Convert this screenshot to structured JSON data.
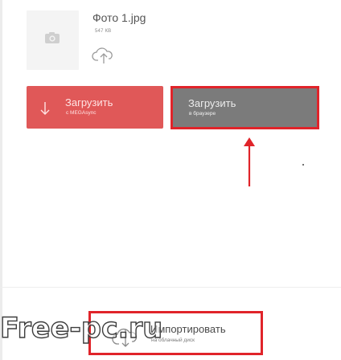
{
  "file": {
    "name": "Фото 1.jpg",
    "size": "547 КВ",
    "thumbnail_icon": "camera-icon",
    "cloud_icon": "cloud-upload-icon"
  },
  "buttons": {
    "megasync": {
      "label": "Загрузить",
      "sub_label": "с MEGAsync",
      "icon": "download-arrow-icon",
      "color": "#e05858"
    },
    "browser": {
      "label": "Загрузить",
      "sub_label": "в браузере",
      "color": "#7b7b7b",
      "highlight_color": "#e0242a"
    },
    "import": {
      "label": "Импортировать",
      "sub_label": "на облачный диск",
      "icon": "cloud-import-icon",
      "highlight_color": "#e0242a"
    }
  },
  "annotation": {
    "arrow_icon": "red-arrow-up-icon",
    "color": "#e0242a"
  },
  "watermark": {
    "text": "Free-pc.ru"
  }
}
